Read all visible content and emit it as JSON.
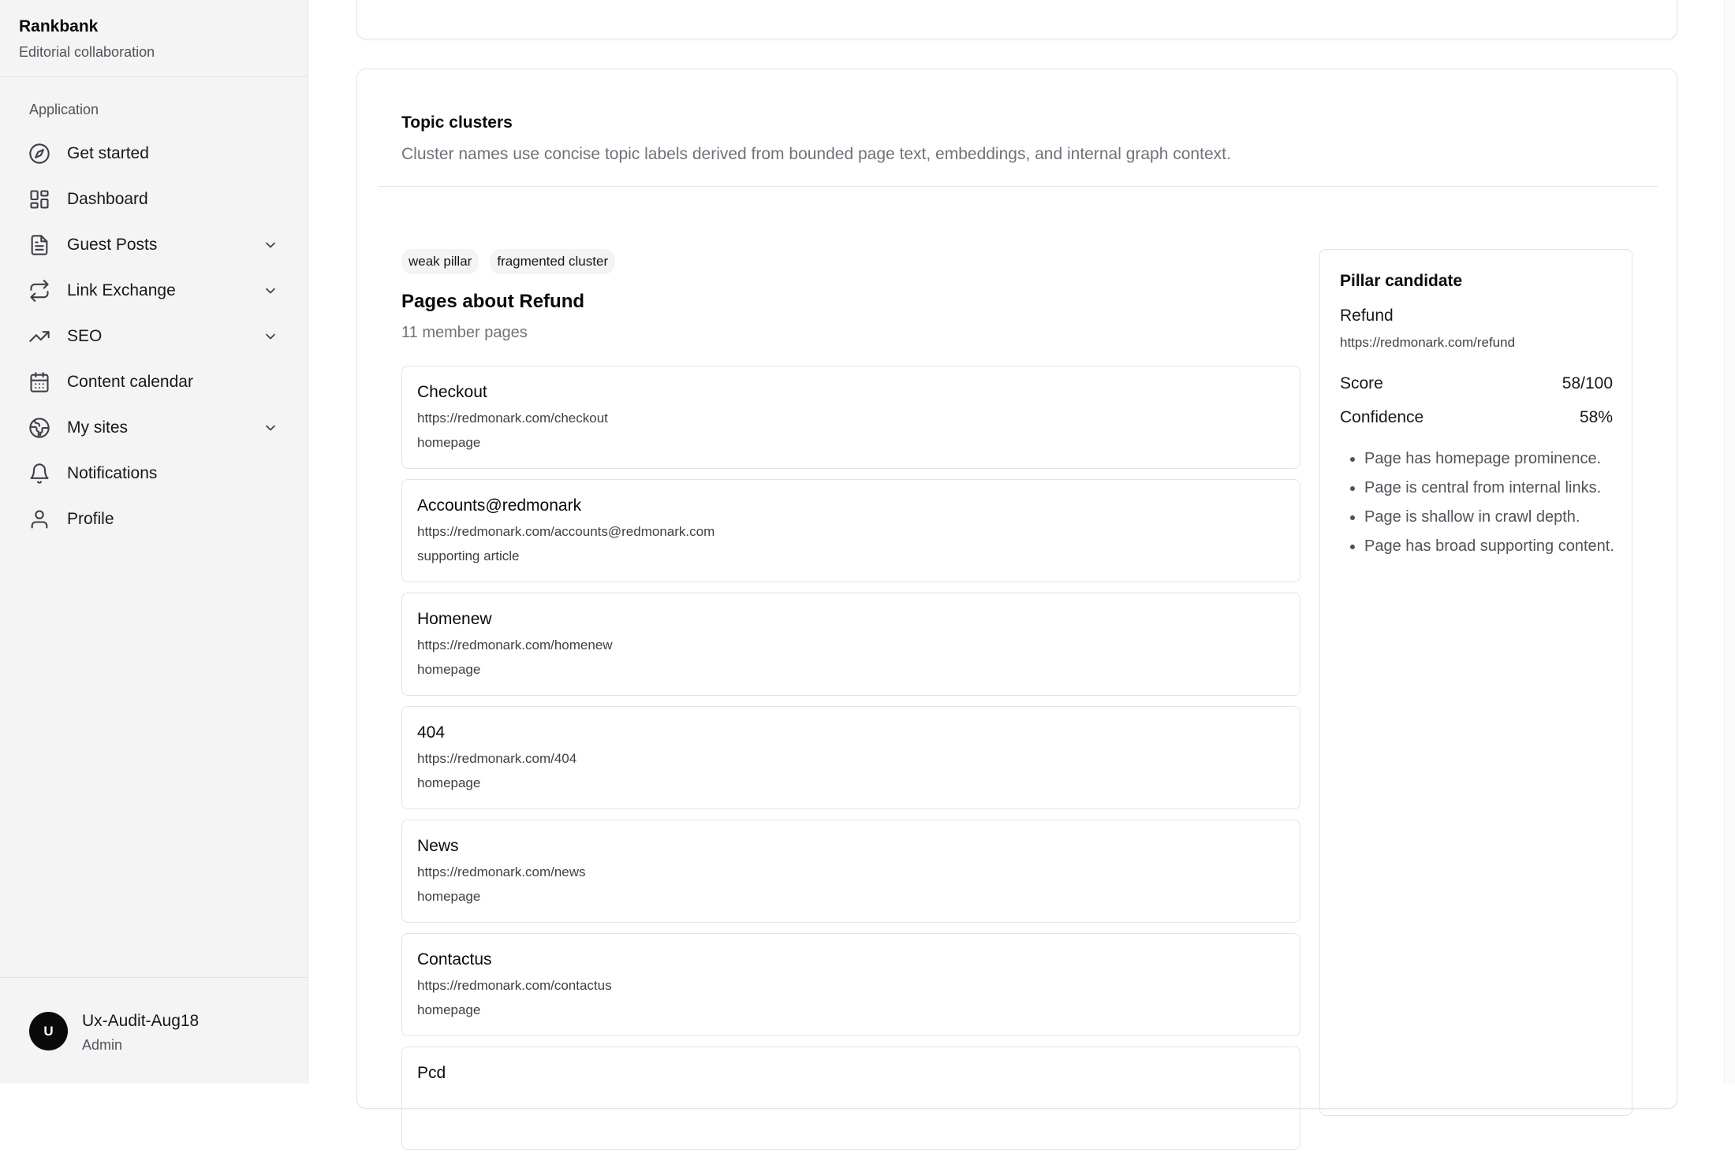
{
  "brand": {
    "name": "Rankbank",
    "subtitle": "Editorial collaboration"
  },
  "sidebar": {
    "group_label": "Application",
    "items": [
      {
        "label": "Get started",
        "icon": "compass-icon",
        "expandable": false
      },
      {
        "label": "Dashboard",
        "icon": "dashboard-icon",
        "expandable": false
      },
      {
        "label": "Guest Posts",
        "icon": "document-icon",
        "expandable": true
      },
      {
        "label": "Link Exchange",
        "icon": "repeat-icon",
        "expandable": true
      },
      {
        "label": "SEO",
        "icon": "trending-up-icon",
        "expandable": true
      },
      {
        "label": "Content calendar",
        "icon": "calendar-icon",
        "expandable": false
      },
      {
        "label": "My sites",
        "icon": "globe-icon",
        "expandable": true
      },
      {
        "label": "Notifications",
        "icon": "bell-icon",
        "expandable": false
      },
      {
        "label": "Profile",
        "icon": "user-icon",
        "expandable": false
      }
    ]
  },
  "user": {
    "initial": "U",
    "name": "Ux-Audit-Aug18",
    "role": "Admin"
  },
  "topic_clusters": {
    "title": "Topic clusters",
    "description": "Cluster names use concise topic labels derived from bounded page text, embeddings, and internal graph context."
  },
  "cluster": {
    "badges": [
      "weak pillar",
      "fragmented cluster"
    ],
    "title": "Pages about Refund",
    "member_count": "11 member pages",
    "pages": [
      {
        "title": "Checkout",
        "url": "https://redmonark.com/checkout",
        "role": "homepage"
      },
      {
        "title": "Accounts@redmonark",
        "url": "https://redmonark.com/accounts@redmonark.com",
        "role": "supporting article"
      },
      {
        "title": "Homenew",
        "url": "https://redmonark.com/homenew",
        "role": "homepage"
      },
      {
        "title": "404",
        "url": "https://redmonark.com/404",
        "role": "homepage"
      },
      {
        "title": "News",
        "url": "https://redmonark.com/news",
        "role": "homepage"
      },
      {
        "title": "Contactus",
        "url": "https://redmonark.com/contactus",
        "role": "homepage"
      },
      {
        "title": "Pcd",
        "url": "",
        "role": ""
      }
    ]
  },
  "pillar": {
    "heading": "Pillar candidate",
    "name": "Refund",
    "url": "https://redmonark.com/refund",
    "score_label": "Score",
    "score_value": "58/100",
    "confidence_label": "Confidence",
    "confidence_value": "58%",
    "reasons": [
      "Page has homepage prominence.",
      "Page is central from internal links.",
      "Page is shallow in crawl depth.",
      "Page has broad supporting content."
    ]
  }
}
